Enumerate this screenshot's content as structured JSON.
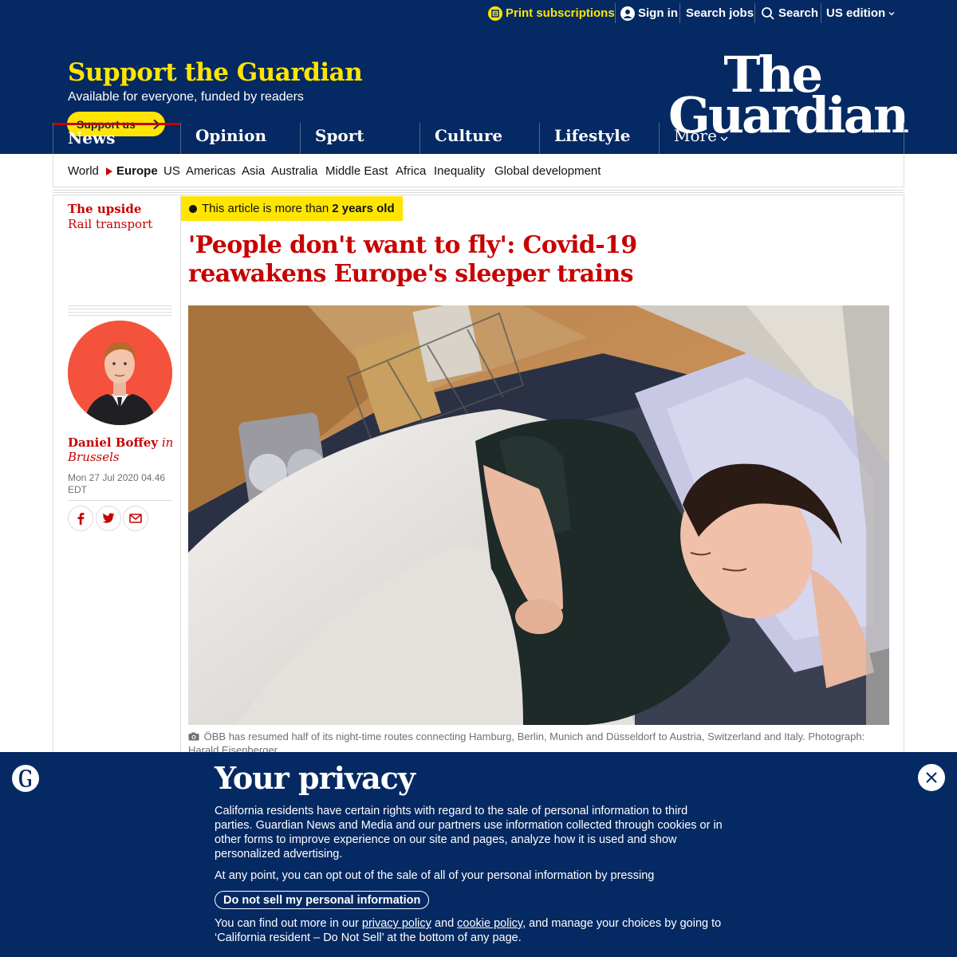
{
  "topbar": {
    "print_subscriptions": "Print subscriptions",
    "sign_in": "Sign in",
    "search_jobs": "Search jobs",
    "search": "Search",
    "edition": "US edition"
  },
  "support": {
    "title": "Support the Guardian",
    "subtitle": "Available for everyone, funded by readers",
    "button": "Support us"
  },
  "logo": {
    "line1": "The",
    "line2": "Guardian"
  },
  "pillars": [
    {
      "label": "News"
    },
    {
      "label": "Opinion"
    },
    {
      "label": "Sport"
    },
    {
      "label": "Culture"
    },
    {
      "label": "Lifestyle"
    },
    {
      "label": "More"
    }
  ],
  "subnav": [
    "World",
    "Europe",
    "US",
    "Americas",
    "Asia",
    "Australia",
    "Middle East",
    "Africa",
    "Inequality",
    "Global development"
  ],
  "article": {
    "series_title": "The upside",
    "series_section": "Rail transport",
    "age_prefix": "This article is more than",
    "age_value": "2 years old",
    "headline": "'People don't want to fly': Covid-19 reawakens Europe's sleeper trains",
    "author": "Daniel Boffey",
    "author_location": "in Brussels",
    "date_line1": "Mon 27 Jul 2020 04.46",
    "date_line2": "EDT",
    "caption": "ÖBB has resumed half of its night-time routes connecting Hamburg, Berlin, Munich and Düsseldorf to Austria, Switzerland and Italy. Photograph: Harald Eisenberger"
  },
  "privacy": {
    "title": "Your privacy",
    "p1": "California residents have certain rights with regard to the sale of personal information to third parties. Guardian News and Media and our partners use information collected through cookies or in other forms to improve experience on our site and pages, analyze how it is used and show personalized advertising.",
    "p2": "At any point, you can opt out of the sale of all of your personal information by pressing",
    "button": "Do not sell my personal information",
    "p3_a": "You can find out more in our",
    "privacy_link": "privacy policy",
    "p3_b": "and",
    "cookie_link": "cookie policy",
    "p3_c": ", and manage your choices by going to ‘California resident – Do Not Sell’ at the bottom of any page."
  },
  "colors": {
    "brand_blue": "#052962",
    "yellow": "#ffe500",
    "news_red": "#c70000"
  }
}
